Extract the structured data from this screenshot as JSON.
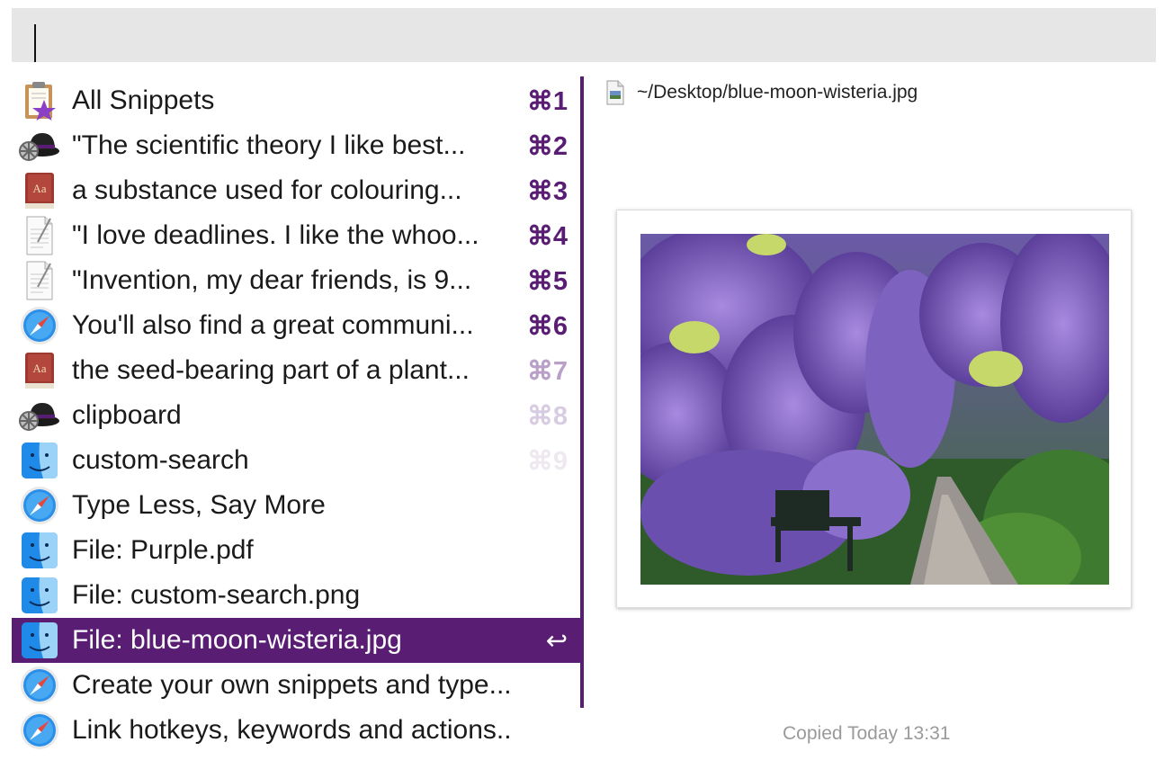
{
  "search": {
    "value": "",
    "placeholder": ""
  },
  "results": [
    {
      "label": "All Snippets",
      "hotkey": "⌘1",
      "icon": "clipboard-star-icon",
      "hotkey_color": "#5a1d74"
    },
    {
      "label": "\"The scientific theory I like best...",
      "hotkey": "⌘2",
      "icon": "bowler-hat-gear-icon",
      "hotkey_color": "#5a1d74"
    },
    {
      "label": "a substance used for colouring...",
      "hotkey": "⌘3",
      "icon": "dictionary-icon",
      "hotkey_color": "#5a1d74"
    },
    {
      "label": "\"I love deadlines. I like the whoo...",
      "hotkey": "⌘4",
      "icon": "text-document-icon",
      "hotkey_color": "#5a1d74"
    },
    {
      "label": "\"Invention, my dear friends, is 9...",
      "hotkey": "⌘5",
      "icon": "text-document-icon",
      "hotkey_color": "#5a1d74"
    },
    {
      "label": "You'll also find a great communi...",
      "hotkey": "⌘6",
      "icon": "safari-compass-icon",
      "hotkey_color": "#5a1d74"
    },
    {
      "label": "the seed-bearing part of a plant...",
      "hotkey": "⌘7",
      "icon": "dictionary-icon",
      "hotkey_color": "#b8a0c8"
    },
    {
      "label": "clipboard",
      "hotkey": "⌘8",
      "icon": "bowler-hat-gear-icon",
      "hotkey_color": "#d8cce2"
    },
    {
      "label": "custom-search",
      "hotkey": "⌘9",
      "icon": "finder-icon",
      "hotkey_color": "#eee8f1"
    },
    {
      "label": "Type Less, Say More",
      "hotkey": "",
      "icon": "safari-compass-icon",
      "hotkey_color": "#5a1d74"
    },
    {
      "label": "File: Purple.pdf",
      "hotkey": "",
      "icon": "finder-icon",
      "hotkey_color": "#5a1d74"
    },
    {
      "label": "File: custom-search.png",
      "hotkey": "",
      "icon": "finder-icon",
      "hotkey_color": "#5a1d74"
    },
    {
      "label": "File: blue-moon-wisteria.jpg",
      "hotkey": "↩",
      "icon": "finder-icon",
      "hotkey_color": "#ffffff",
      "selected": true
    },
    {
      "label": "Create your own snippets and type...",
      "hotkey": "",
      "icon": "safari-compass-icon",
      "hotkey_color": "#5a1d74"
    },
    {
      "label": "Link hotkeys, keywords and actions...",
      "hotkey": "",
      "icon": "safari-compass-icon",
      "hotkey_color": "#5a1d74"
    }
  ],
  "preview": {
    "path": "~/Desktop/blue-moon-wisteria.jpg",
    "file_icon": "image-file-icon",
    "image_subject": "wisteria-garden-image",
    "copied_text": "Copied Today 13:31"
  },
  "colors": {
    "accent": "#5a1d74",
    "search_bg": "#e6e6e6"
  }
}
